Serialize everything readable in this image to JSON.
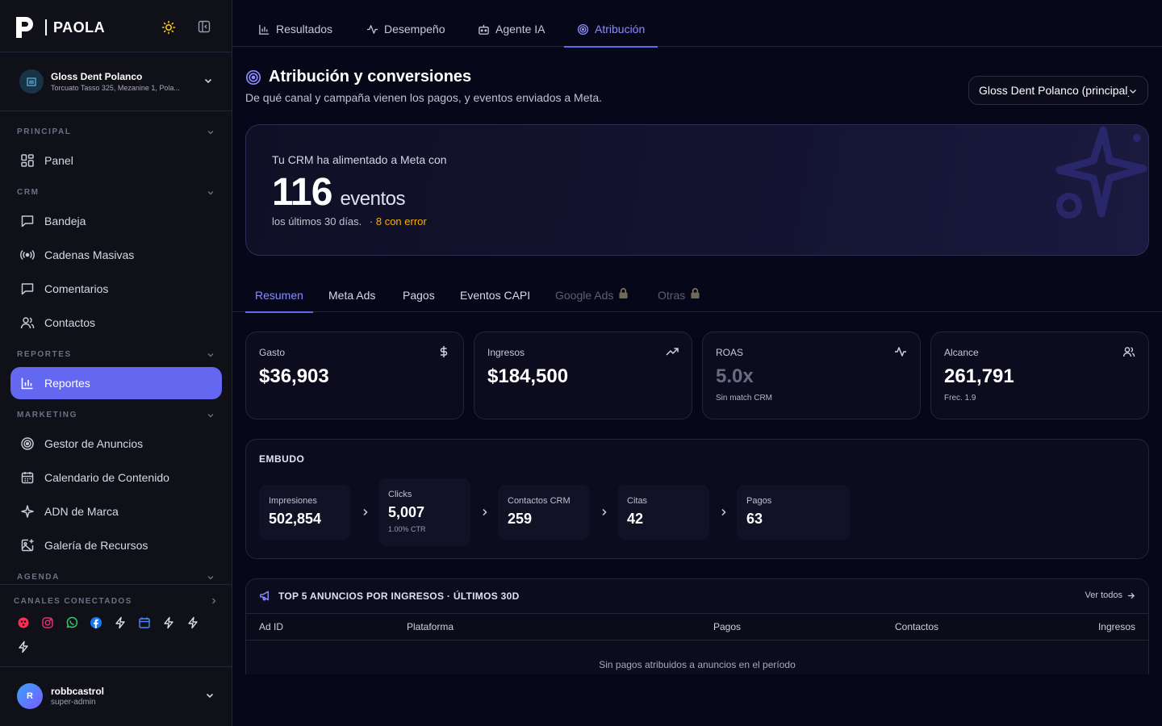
{
  "brand": {
    "name": "PAOLA"
  },
  "clinic": {
    "name": "Gloss Dent Polanco",
    "address": "Torcuato Tasso 325, Mezanine 1, Pola..."
  },
  "sidebar": {
    "sections": {
      "principal": "PRINCIPAL",
      "crm": "CRM",
      "reportes": "REPORTES",
      "marketing": "MARKETING",
      "agenda": "AGENDA"
    },
    "items": {
      "panel": "Panel",
      "bandeja": "Bandeja",
      "cadenas": "Cadenas Masivas",
      "comentarios": "Comentarios",
      "contactos": "Contactos",
      "reportes": "Reportes",
      "gestor": "Gestor de Anuncios",
      "calendario": "Calendario de Contenido",
      "adn": "ADN de Marca",
      "galeria": "Galería de Recursos"
    },
    "channels_label": "CANALES CONECTADOS",
    "channels": [
      "tiktok-icon",
      "instagram-icon",
      "whatsapp-icon",
      "facebook-icon",
      "bolt-icon",
      "calendar-icon",
      "bolt-icon",
      "bolt-icon",
      "bolt-icon"
    ]
  },
  "user": {
    "name": "robbcastrol",
    "role": "super-admin",
    "initial": "R"
  },
  "topnav": {
    "tabs": {
      "resultados": "Resultados",
      "desempeno": "Desempeño",
      "agente": "Agente IA",
      "atribucion": "Atribución"
    },
    "active": "atribucion"
  },
  "page": {
    "title": "Atribución y conversiones",
    "subtitle": "De qué canal y campaña vienen los pagos, y eventos enviados a Meta.",
    "location_select": "Gloss Dent Polanco (principal)"
  },
  "hero": {
    "label": "Tu CRM ha alimentado a Meta con",
    "value": "116",
    "unit": "eventos",
    "period": "los últimos 30 días.",
    "errors": "· 8 con error"
  },
  "subtabs": {
    "resumen": "Resumen",
    "meta_ads": "Meta Ads",
    "pagos": "Pagos",
    "eventos_capi": "Eventos CAPI",
    "google_ads": "Google Ads",
    "otras": "Otras",
    "active": "resumen"
  },
  "kpis": {
    "gasto": {
      "label": "Gasto",
      "value": "$36,903"
    },
    "ingresos": {
      "label": "Ingresos",
      "value": "$184,500"
    },
    "roas": {
      "label": "ROAS",
      "value": "5.0x",
      "sub": "Sin match CRM"
    },
    "alcance": {
      "label": "Alcance",
      "value": "261,791",
      "sub": "Frec. 1.9"
    }
  },
  "funnel": {
    "title": "EMBUDO",
    "steps": {
      "impresiones": {
        "label": "Impresiones",
        "value": "502,854"
      },
      "clicks": {
        "label": "Clicks",
        "value": "5,007",
        "sub": "1.00% CTR"
      },
      "contactos": {
        "label": "Contactos CRM",
        "value": "259"
      },
      "citas": {
        "label": "Citas",
        "value": "42"
      },
      "pagos": {
        "label": "Pagos",
        "value": "63"
      }
    }
  },
  "top_ads": {
    "title": "TOP 5 ANUNCIOS POR INGRESOS · ÚLTIMOS 30D",
    "see_all": "Ver todos",
    "columns": {
      "ad_id": "Ad ID",
      "plataforma": "Plataforma",
      "pagos": "Pagos",
      "contactos": "Contactos",
      "ingresos": "Ingresos"
    },
    "empty": "Sin pagos atribuidos a anuncios en el período"
  },
  "colors": {
    "accent": "#6468f0",
    "background": "#07071a",
    "sidebar": "#101018",
    "warning": "#f5b300"
  }
}
